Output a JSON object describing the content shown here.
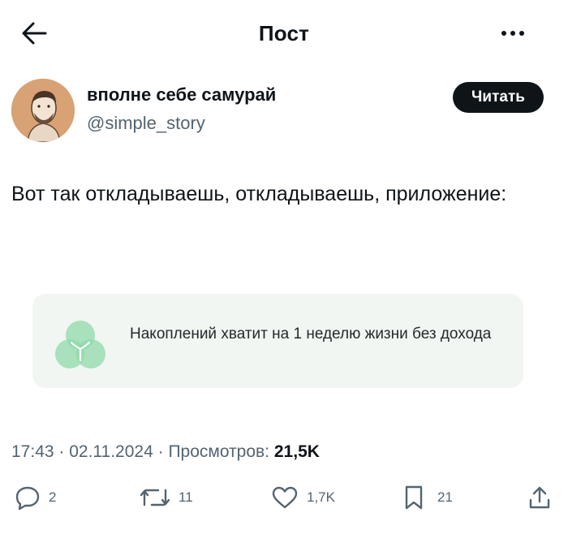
{
  "header": {
    "title": "Пост",
    "back_icon": "arrow-left-icon",
    "more_icon": "more-horizontal-icon"
  },
  "author": {
    "display_name": "вполне себе самурай",
    "handle": "@simple_story",
    "follow_label": "Читать"
  },
  "post": {
    "text": "Вот так откладываешь, откладываешь, приложение:",
    "card": {
      "logo_icon": "three-leaf-logo-icon",
      "logo_color": "#8fd9a8",
      "text": "Накоплений хватит на 1 неделю жизни без дохода"
    },
    "time": "17:43",
    "date": "02.11.2024",
    "views_label": "Просмотров:",
    "views_count": "21,5K"
  },
  "actions": {
    "reply": {
      "icon": "reply-icon",
      "count": "2"
    },
    "repost": {
      "icon": "repost-icon",
      "count": "11"
    },
    "like": {
      "icon": "heart-icon",
      "count": "1,7K"
    },
    "bookmark": {
      "icon": "bookmark-icon",
      "count": "21"
    },
    "share": {
      "icon": "share-icon"
    }
  },
  "colors": {
    "text": "#0f1419",
    "secondary": "#536471",
    "button_bg": "#0f1419",
    "card_bg": "#f1f6f2"
  }
}
